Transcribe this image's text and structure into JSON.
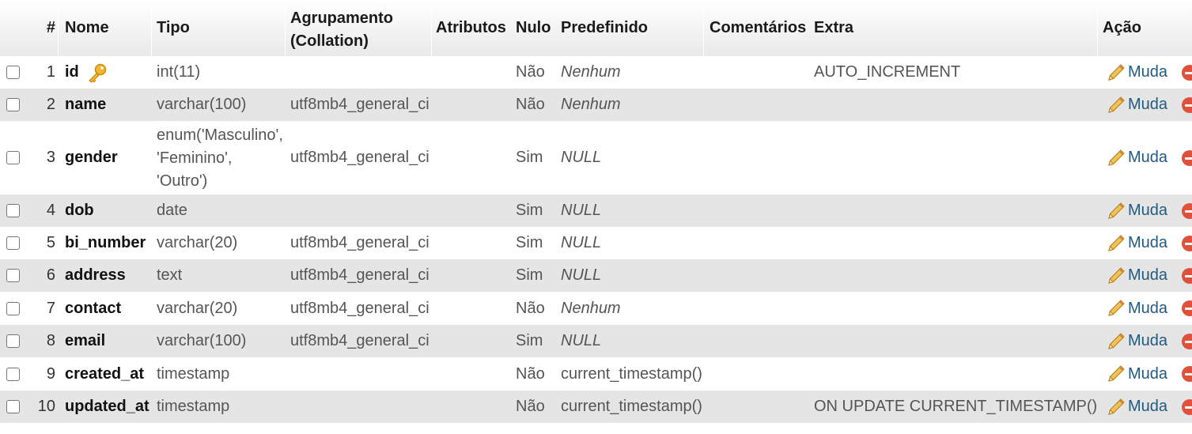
{
  "header": {
    "num": "#",
    "name": "Nome",
    "type": "Tipo",
    "collation": "Agrupamento (Collation)",
    "attributes": "Atributos",
    "null": "Nulo",
    "default": "Predefinido",
    "comments": "Comentários",
    "extra": "Extra",
    "action": "Ação"
  },
  "change_label": "Muda",
  "rows": [
    {
      "num": "1",
      "name": "id",
      "type": "int(11)",
      "collation": "",
      "null": "Não",
      "default": "Nenhum",
      "extra": "AUTO_INCREMENT",
      "primary_key": true
    },
    {
      "num": "2",
      "name": "name",
      "type": "varchar(100)",
      "collation": "utf8mb4_general_ci",
      "null": "Não",
      "default": "Nenhum",
      "extra": ""
    },
    {
      "num": "3",
      "name": "gender",
      "type": "enum('Masculino', 'Feminino', 'Outro')",
      "collation": "utf8mb4_general_ci",
      "null": "Sim",
      "default": "NULL",
      "extra": ""
    },
    {
      "num": "4",
      "name": "dob",
      "type": "date",
      "collation": "",
      "null": "Sim",
      "default": "NULL",
      "extra": ""
    },
    {
      "num": "5",
      "name": "bi_number",
      "type": "varchar(20)",
      "collation": "utf8mb4_general_ci",
      "null": "Sim",
      "default": "NULL",
      "extra": ""
    },
    {
      "num": "6",
      "name": "address",
      "type": "text",
      "collation": "utf8mb4_general_ci",
      "null": "Sim",
      "default": "NULL",
      "extra": ""
    },
    {
      "num": "7",
      "name": "contact",
      "type": "varchar(20)",
      "collation": "utf8mb4_general_ci",
      "null": "Não",
      "default": "Nenhum",
      "extra": ""
    },
    {
      "num": "8",
      "name": "email",
      "type": "varchar(100)",
      "collation": "utf8mb4_general_ci",
      "null": "Sim",
      "default": "NULL",
      "extra": ""
    },
    {
      "num": "9",
      "name": "created_at",
      "type": "timestamp",
      "collation": "",
      "null": "Não",
      "default": "current_timestamp()",
      "extra": ""
    },
    {
      "num": "10",
      "name": "updated_at",
      "type": "timestamp",
      "collation": "",
      "null": "Não",
      "default": "current_timestamp()",
      "extra": "ON UPDATE CURRENT_TIMESTAMP()"
    }
  ],
  "icons": {
    "primary_key": "key-icon",
    "change": "pencil-icon",
    "drop": "delete-icon"
  }
}
